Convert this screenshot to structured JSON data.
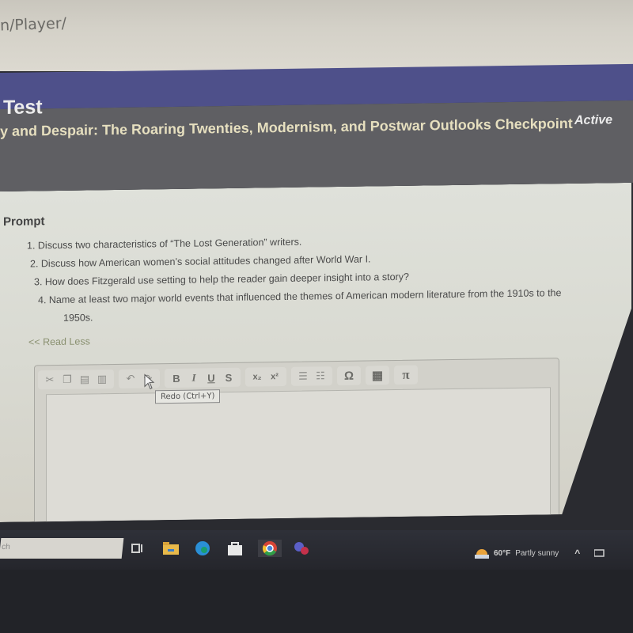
{
  "browser": {
    "address_fragment": "n/Player/"
  },
  "header": {
    "title": "Test",
    "subtitle": "y and Despair: The Roaring Twenties, Modernism, and Postwar Outlooks Checkpoint",
    "status": "Active"
  },
  "prompt": {
    "label": "Prompt",
    "items": [
      "1. Discuss two characteristics of “The Lost Generation” writers.",
      "2. Discuss how American women’s social attitudes changed after World War I.",
      "3. How does Fitzgerald use setting to help the reader gain deeper insight into a story?",
      "4. Name at least two major world events that influenced the themes of American modern literature from the 1910s to the"
    ],
    "item4_continuation": "1950s.",
    "read_less": "<< Read Less"
  },
  "editor": {
    "toolbar": {
      "cut": "✂",
      "copy": "❐",
      "paste": "▤",
      "paste_text": "▥",
      "undo": "↶",
      "redo": "↷",
      "bold": "B",
      "italic": "I",
      "underline": "U",
      "strike": "S",
      "subscript": "x₂",
      "superscript": "x²",
      "numbered_list": "☰",
      "bulleted_list": "☷",
      "special_char": "Ω",
      "table": "▦",
      "math": "π"
    },
    "tooltip": "Redo (Ctrl+Y)",
    "content": ""
  },
  "taskbar": {
    "search_placeholder": "ch",
    "weather_temp": "60°F",
    "weather_desc": "Partly sunny",
    "tray_chevron": "^"
  },
  "colors": {
    "accent_bar": "#4e508a",
    "header_bg": "#5f5f63",
    "subtitle": "#e6dfbf"
  }
}
